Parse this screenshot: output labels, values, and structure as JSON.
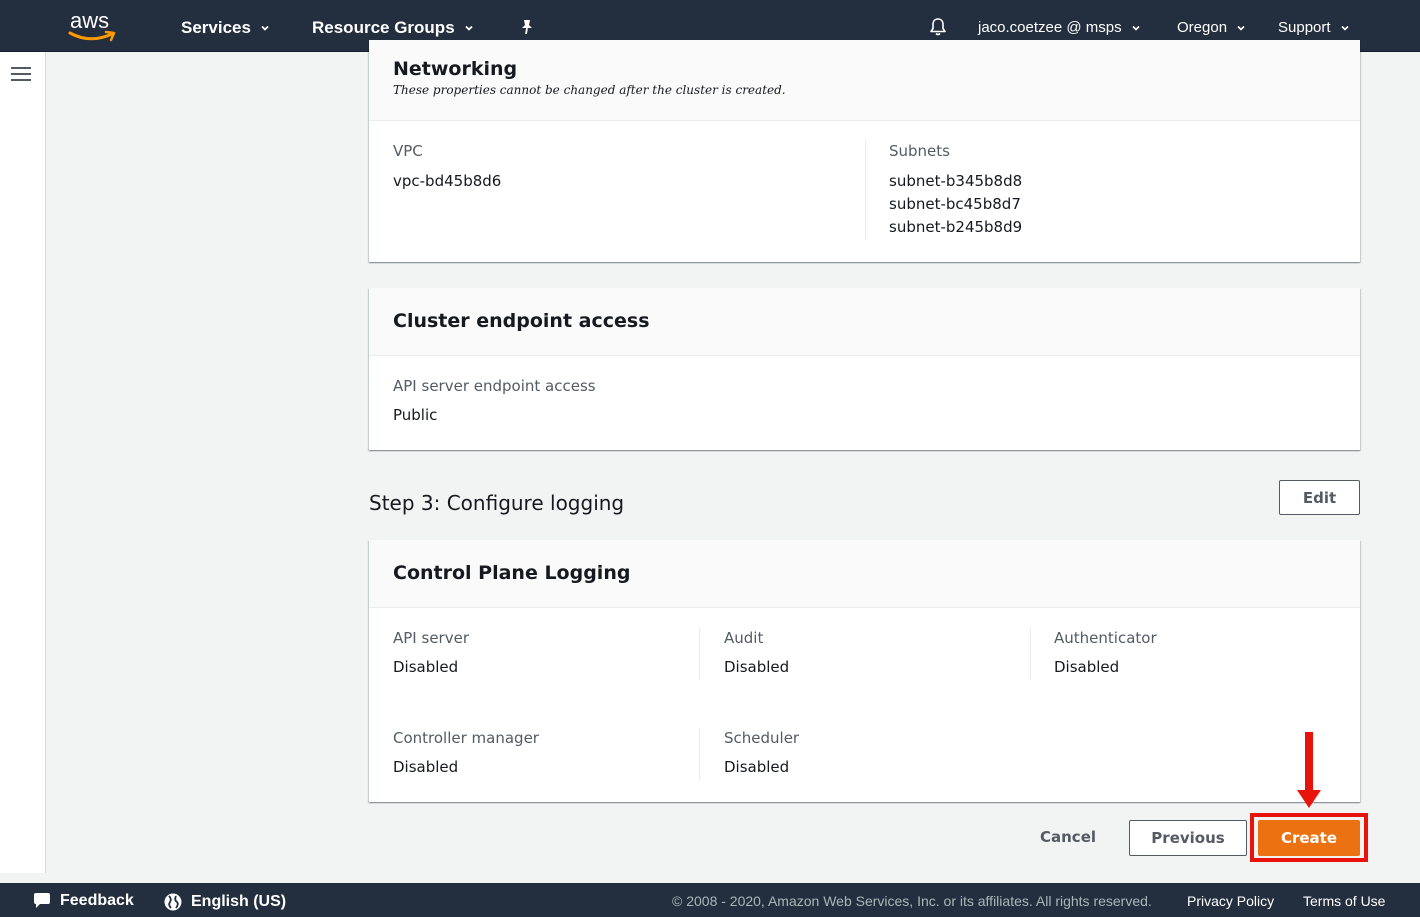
{
  "header": {
    "logo_text": "aws",
    "services_label": "Services",
    "resource_groups_label": "Resource Groups",
    "account_label": "jaco.coetzee @ msps",
    "region_label": "Oregon",
    "support_label": "Support"
  },
  "networking": {
    "title": "Networking",
    "subtitle": "These properties cannot be changed after the cluster is created.",
    "vpc_label": "VPC",
    "vpc_value": "vpc-bd45b8d6",
    "subnets_label": "Subnets",
    "subnets": [
      "subnet-b345b8d8",
      "subnet-bc45b8d7",
      "subnet-b245b8d9"
    ]
  },
  "endpoint": {
    "title": "Cluster endpoint access",
    "label": "API server endpoint access",
    "value": "Public"
  },
  "step3": {
    "title": "Step 3: Configure logging",
    "edit_label": "Edit"
  },
  "logging": {
    "title": "Control Plane Logging",
    "items": [
      {
        "label": "API server",
        "value": "Disabled"
      },
      {
        "label": "Audit",
        "value": "Disabled"
      },
      {
        "label": "Authenticator",
        "value": "Disabled"
      },
      {
        "label": "Controller manager",
        "value": "Disabled"
      },
      {
        "label": "Scheduler",
        "value": "Disabled"
      }
    ]
  },
  "actions": {
    "cancel_label": "Cancel",
    "previous_label": "Previous",
    "create_label": "Create"
  },
  "footer": {
    "feedback_label": "Feedback",
    "language_label": "English (US)",
    "copyright": "© 2008 - 2020, Amazon Web Services, Inc. or its affiliates. All rights reserved.",
    "privacy_label": "Privacy Policy",
    "terms_label": "Terms of Use"
  },
  "colors": {
    "nav_bg": "#232f3e",
    "primary": "#ec7211",
    "annotation_red": "#e8140c",
    "page_bg": "#f2f3f3"
  },
  "icons": [
    "aws-logo-icon",
    "caret-down-icon",
    "pin-icon",
    "bell-icon",
    "hamburger-icon",
    "feedback-icon",
    "globe-icon",
    "red-arrow-annotation"
  ]
}
